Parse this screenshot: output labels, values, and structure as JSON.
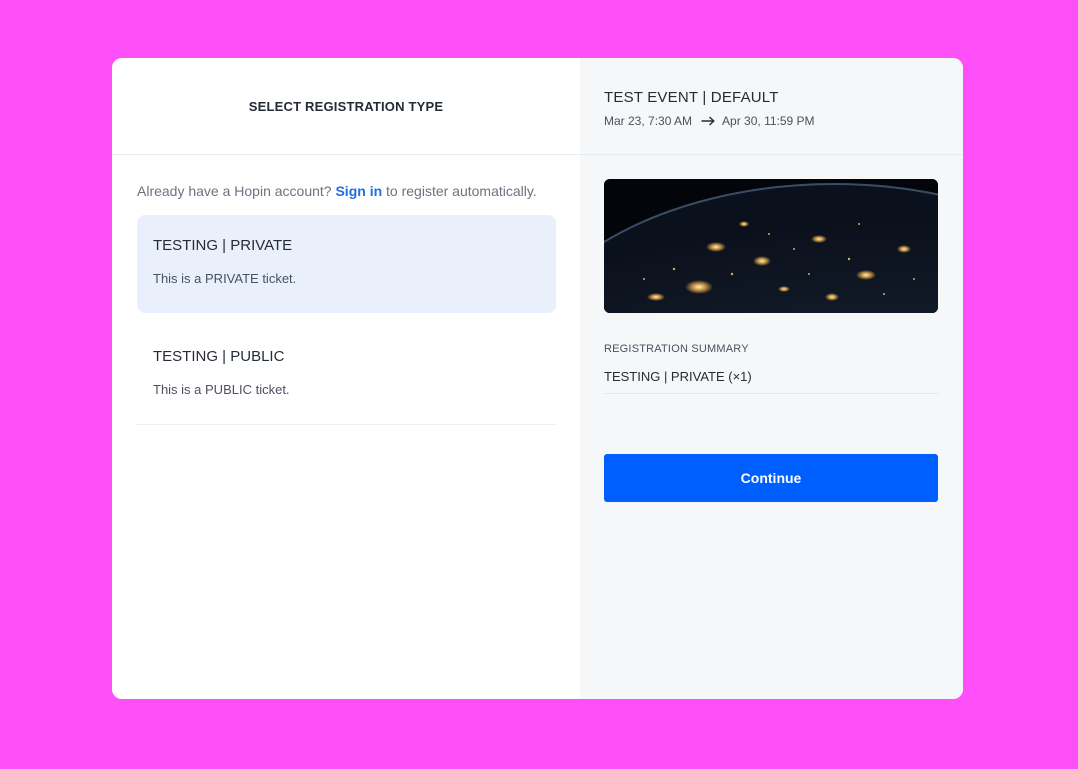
{
  "registration": {
    "title": "SELECT REGISTRATION TYPE",
    "signin_prefix": "Already have a Hopin account?",
    "signin_link": "Sign in",
    "signin_suffix": "to register automatically.",
    "tickets": [
      {
        "name": "TESTING | PRIVATE",
        "description": "This is a PRIVATE ticket.",
        "selected": true
      },
      {
        "name": "TESTING | PUBLIC",
        "description": "This is a PUBLIC ticket.",
        "selected": false
      }
    ]
  },
  "event": {
    "title": "TEST EVENT | DEFAULT",
    "start": "Mar 23, 7:30 AM",
    "end": "Apr 30, 11:59 PM",
    "arrow_icon": "arrow-right-icon",
    "image": "earth-at-night-image"
  },
  "summary": {
    "label": "REGISTRATION SUMMARY",
    "item": "TESTING | PRIVATE (×1)"
  },
  "actions": {
    "continue_label": "Continue"
  },
  "colors": {
    "page_background": "#ff4ff8",
    "accent": "#0060ff",
    "link": "#1f6fe0",
    "selected_ticket": "#e9f0fc",
    "right_panel": "#f6f7f9"
  }
}
